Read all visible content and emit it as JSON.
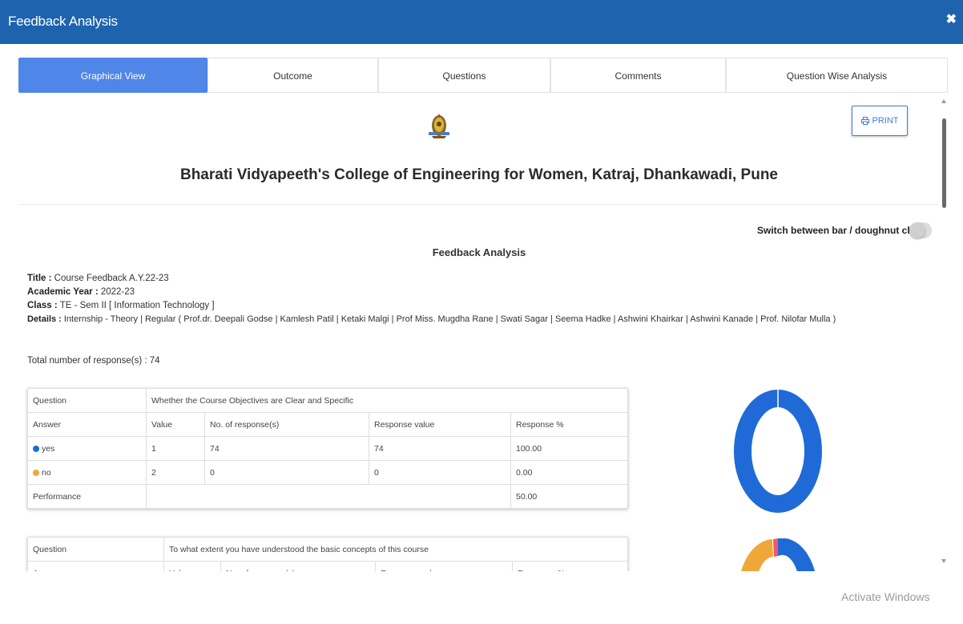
{
  "header": {
    "title": "Feedback Analysis",
    "close": "✖"
  },
  "tabs": [
    {
      "label": "Graphical View",
      "active": true
    },
    {
      "label": "Outcome"
    },
    {
      "label": "Questions"
    },
    {
      "label": "Comments"
    },
    {
      "label": "Question Wise Analysis"
    }
  ],
  "toolbar": {
    "print_label": "PRINT"
  },
  "college": {
    "name": "Bharati Vidyapeeth's College of Engineering for Women, Katraj, Dhankawadi, Pune"
  },
  "chart_switch": {
    "label": "Switch between bar / doughnut chart"
  },
  "section_title": "Feedback Analysis",
  "meta": {
    "title_label": "Title :",
    "title_value": " Course Feedback A.Y.22-23",
    "year_label": "Academic Year :",
    "year_value": " 2022-23",
    "class_label": "Class :",
    "class_value": " TE - Sem II [ Information Technology ]",
    "details_label": "Details :",
    "details_value": " Internship - Theory | Regular ( Prof.dr. Deepali Godse | Kamlesh Patil | Ketaki Malgi | Prof Miss. Mugdha Rane | Swati Sagar | Seema Hadke | Ashwini Khairkar | Ashwini Kanade | Prof. Nilofar Mulla )"
  },
  "total_responses": "Total number of response(s) : 74",
  "table1": {
    "question_label": "Question",
    "question": "Whether the Course Objectives are Clear and Specific",
    "headers": [
      "Answer",
      "Value",
      "No. of response(s)",
      "Response value",
      "Response %"
    ],
    "rows": [
      {
        "answer": "yes",
        "value": "1",
        "responses": "74",
        "response_value": "74",
        "percent": "100.00",
        "color": "#1f6ad6"
      },
      {
        "answer": "no",
        "value": "2",
        "responses": "0",
        "response_value": "0",
        "percent": "0.00",
        "color": "#f0a73a"
      }
    ],
    "performance_label": "Performance",
    "performance_value": "50.00"
  },
  "table2": {
    "question_label": "Question",
    "question": "To what extent you have understood the basic concepts of this course",
    "headers": [
      "Answer",
      "Value",
      "No. of response(s)",
      "Response value",
      "Response %"
    ]
  },
  "colors": {
    "header": "#1e63ad",
    "active_tab": "#4f86e8",
    "yes": "#1f6ad6",
    "no": "#f0a73a",
    "third": "#ef5b6c"
  },
  "watermark": "Activate Windows"
}
